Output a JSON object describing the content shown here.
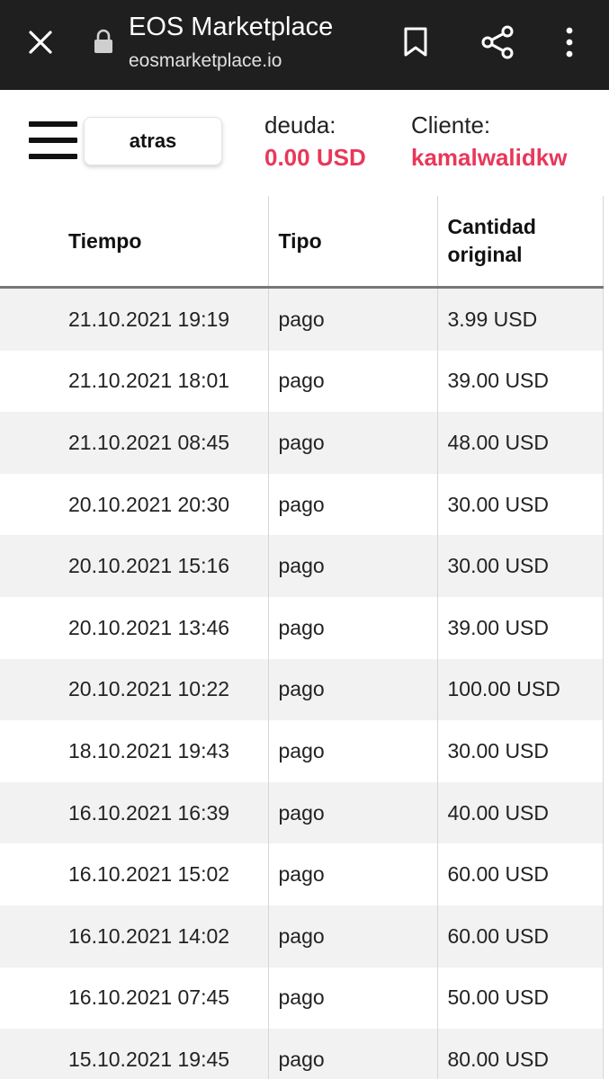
{
  "browser": {
    "title": "EOS Marketplace",
    "url": "eosmarketplace.io",
    "icons": [
      "close-icon",
      "lock-icon",
      "bookmark-icon",
      "share-icon",
      "more-vert-icon"
    ],
    "bar_color": "#1f1f1f"
  },
  "header": {
    "back_label": "atras",
    "debt_label": "deuda:",
    "debt_value": "0.00 USD",
    "client_label": "Cliente:",
    "client_value": "kamalwalidkw",
    "accent_color": "#e8375a"
  },
  "table": {
    "columns": [
      "Tiempo",
      "Tipo",
      "Cantidad original"
    ],
    "rows": [
      {
        "time": "21.10.2021 19:19",
        "type": "pago",
        "amount": "3.99 USD"
      },
      {
        "time": "21.10.2021 18:01",
        "type": "pago",
        "amount": "39.00 USD"
      },
      {
        "time": "21.10.2021 08:45",
        "type": "pago",
        "amount": "48.00 USD"
      },
      {
        "time": "20.10.2021 20:30",
        "type": "pago",
        "amount": "30.00 USD"
      },
      {
        "time": "20.10.2021 15:16",
        "type": "pago",
        "amount": "30.00 USD"
      },
      {
        "time": "20.10.2021 13:46",
        "type": "pago",
        "amount": "39.00 USD"
      },
      {
        "time": "20.10.2021 10:22",
        "type": "pago",
        "amount": "100.00 USD"
      },
      {
        "time": "18.10.2021 19:43",
        "type": "pago",
        "amount": "30.00 USD"
      },
      {
        "time": "16.10.2021 16:39",
        "type": "pago",
        "amount": "40.00 USD"
      },
      {
        "time": "16.10.2021 15:02",
        "type": "pago",
        "amount": "60.00 USD"
      },
      {
        "time": "16.10.2021 14:02",
        "type": "pago",
        "amount": "60.00 USD"
      },
      {
        "time": "16.10.2021 07:45",
        "type": "pago",
        "amount": "50.00 USD"
      },
      {
        "time": "15.10.2021 19:45",
        "type": "pago",
        "amount": "80.00 USD"
      }
    ]
  }
}
